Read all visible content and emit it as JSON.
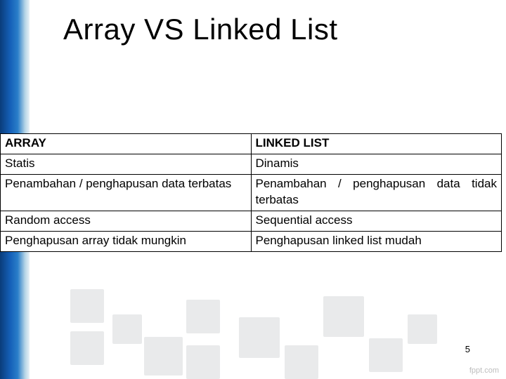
{
  "title": "Array VS Linked List",
  "table": {
    "header": {
      "left": "ARRAY",
      "right": "LINKED LIST"
    },
    "rows": [
      {
        "left": "Statis",
        "right": "Dinamis"
      },
      {
        "left": "Penambahan / penghapusan data terbatas",
        "right": "Penambahan / penghapusan data tidak terbatas"
      },
      {
        "left": "Random access",
        "right": "Sequential access"
      },
      {
        "left": "Penghapusan array tidak mungkin",
        "right": "Penghapusan linked list mudah"
      }
    ]
  },
  "page_number": "5",
  "watermark": "fppt.com"
}
